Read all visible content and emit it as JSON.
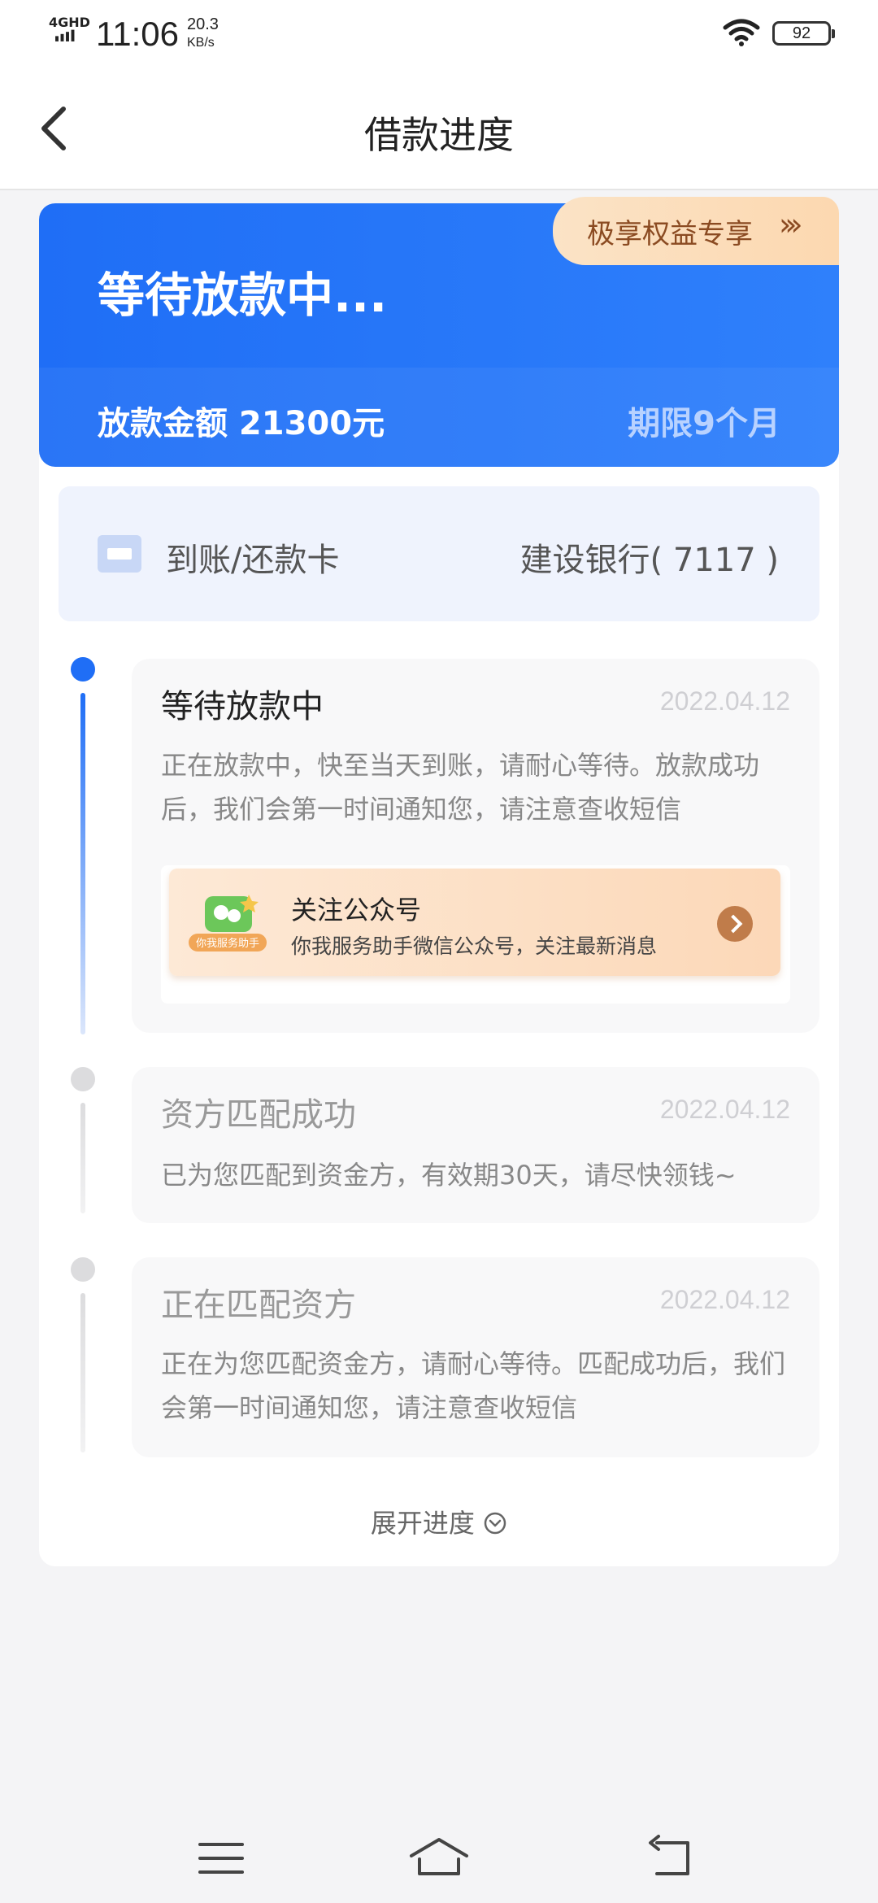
{
  "status_bar": {
    "network": "4GHD",
    "time": "11:06",
    "speed_value": "20.3",
    "speed_unit": "KB/s",
    "battery": "92"
  },
  "nav": {
    "title": "借款进度",
    "back_icon": "chevron-left-icon"
  },
  "hero": {
    "status_title": "等待放款中...",
    "amount_text": "放款金额 21300元",
    "term_text": "期限9个月",
    "promo_label": "极享权益专享",
    "promo_arrows": "›››"
  },
  "card_row": {
    "label": "到账/还款卡",
    "bank": "建设银行( 7117 )",
    "icon": "bank-card-icon"
  },
  "timeline": [
    {
      "title": "等待放款中",
      "date": "2022.04.12",
      "desc": "正在放款中，快至当天到账，请耐心等待。放款成功后，我们会第一时间通知您，请注意查收短信",
      "active": true
    },
    {
      "title": "资方匹配成功",
      "date": "2022.04.12",
      "desc": "已为您匹配到资金方，有效期30天，请尽快领钱~",
      "active": false
    },
    {
      "title": "正在匹配资方",
      "date": "2022.04.12",
      "desc": "正在为您匹配资金方，请耐心等待。匹配成功后，我们会第一时间通知您，请注意查收短信",
      "active": false
    }
  ],
  "wechat_banner": {
    "title": "关注公众号",
    "subtitle": "你我服务助手微信公众号，关注最新消息",
    "badge": "你我服务助手"
  },
  "expand_label": "展开进度",
  "colors": {
    "primary": "#1f6ef6",
    "promo_text": "#8b4b22",
    "inactive_dot": "#dcdcde"
  },
  "bottom_nav": {
    "items": [
      "menu-icon",
      "home-icon",
      "back-icon"
    ]
  }
}
